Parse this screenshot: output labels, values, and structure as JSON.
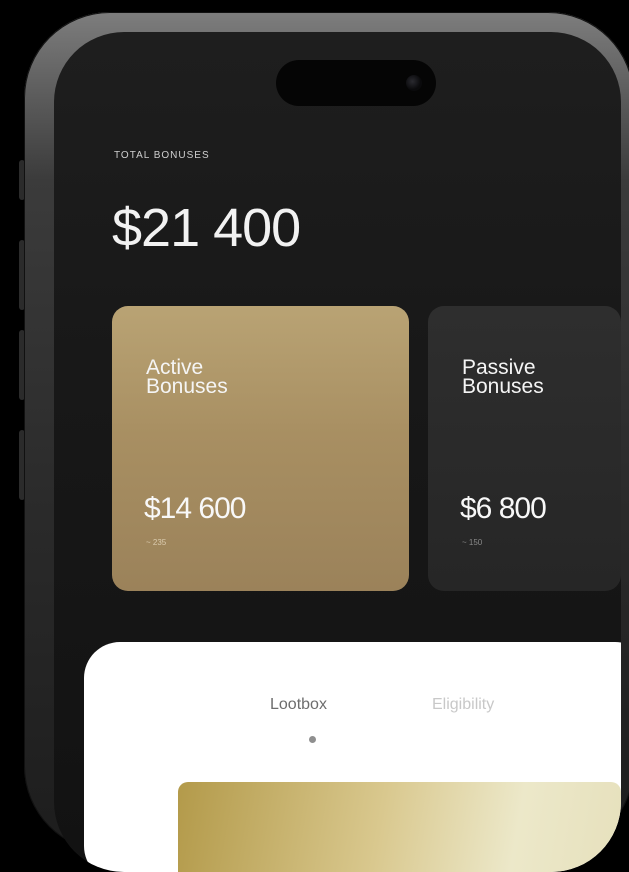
{
  "header": {
    "total_label": "TOTAL BONUSES",
    "total_amount": "$21 400"
  },
  "cards": [
    {
      "title": "Active Bonuses",
      "value": "$14 600",
      "sub": "~ 235"
    },
    {
      "title": "Passive Bonuses",
      "value": "$6 800",
      "sub": "~ 150"
    }
  ],
  "tabs": [
    {
      "label": "Lootbox",
      "selected": true
    },
    {
      "label": "Eligibility",
      "selected": false
    }
  ],
  "colors": {
    "background": "#000000",
    "screen": "#1b1b1b",
    "gold": "#a88f62",
    "card_dark": "#2a2a2a",
    "sheet": "#ffffff"
  }
}
